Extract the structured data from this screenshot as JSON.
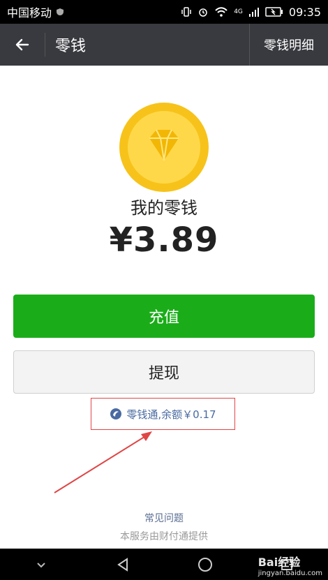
{
  "status": {
    "carrier": "中国移动",
    "network": "4G",
    "time": "09:35"
  },
  "appbar": {
    "title": "零钱",
    "details_link": "零钱明细"
  },
  "balance": {
    "caption": "我的零钱",
    "amount": "¥3.89"
  },
  "buttons": {
    "recharge": "充值",
    "withdraw": "提现"
  },
  "fund": {
    "text": "零钱通,余额￥0.17"
  },
  "footer": {
    "faq": "常见问题",
    "provided_by": "本服务由财付通提供"
  },
  "watermark": {
    "brand": "Bai经验",
    "site": "jingyan.baidu.com"
  },
  "colors": {
    "appbar_bg": "#393a3f",
    "primary_green": "#1aad19",
    "coin_gold": "#f7c31a",
    "link_blue": "#4a6aa1",
    "highlight_red": "#e04545"
  }
}
